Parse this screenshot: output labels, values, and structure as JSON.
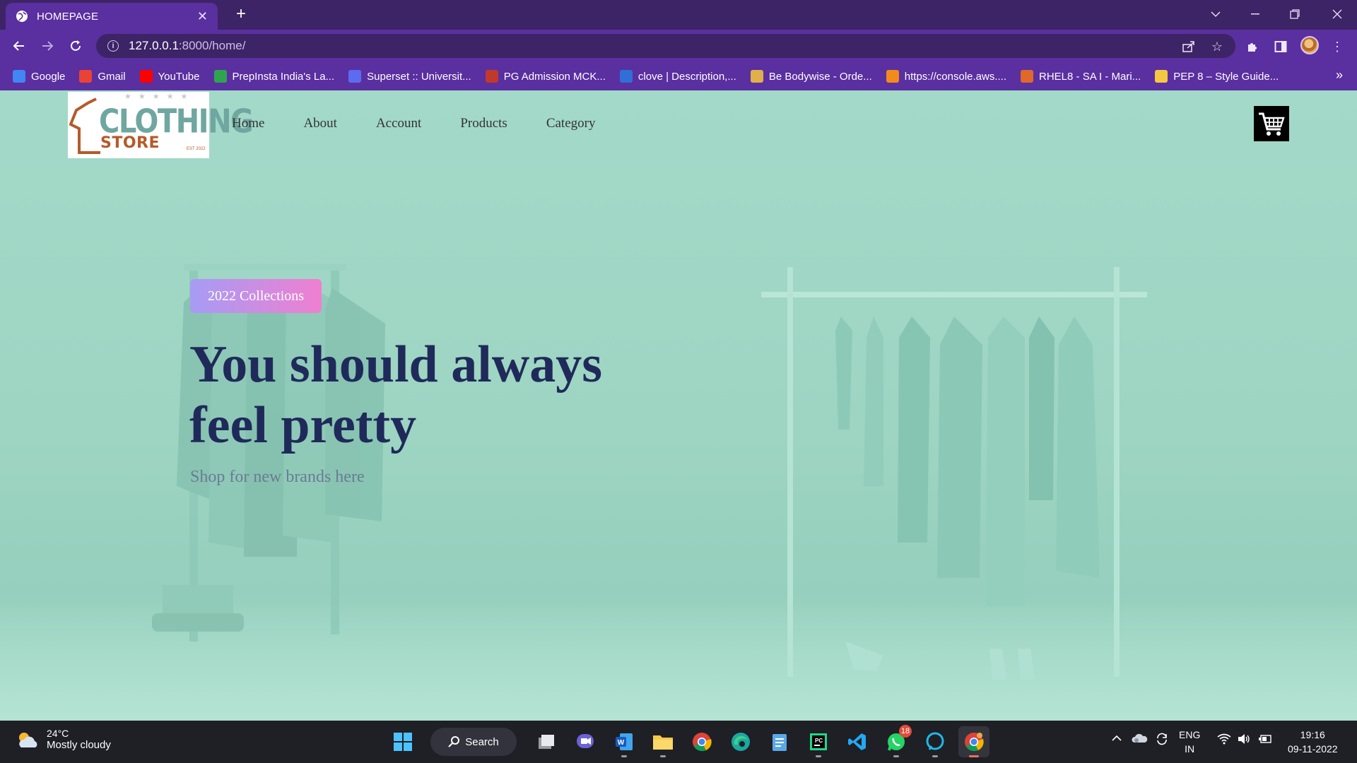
{
  "browser": {
    "tab_title": "HOMEPAGE",
    "url_host": "127.0.0.1",
    "url_path": ":8000/home/",
    "bookmarks": [
      {
        "label": "Google",
        "icon": "google-icon",
        "color": "#4285f4"
      },
      {
        "label": "Gmail",
        "icon": "gmail-icon",
        "color": "#ea4335"
      },
      {
        "label": "YouTube",
        "icon": "youtube-icon",
        "color": "#ff0000"
      },
      {
        "label": "PrepInsta India's La...",
        "icon": "prepinsta-icon",
        "color": "#2ea44f"
      },
      {
        "label": "Superset :: Universit...",
        "icon": "superset-icon",
        "color": "#5b6cf0"
      },
      {
        "label": "PG Admission MCK...",
        "icon": "pg-admission-icon",
        "color": "#c0392b"
      },
      {
        "label": "clove | Description,...",
        "icon": "clove-icon",
        "color": "#2f6fd6"
      },
      {
        "label": "Be Bodywise - Orde...",
        "icon": "bodywise-icon",
        "color": "#e0b04a"
      },
      {
        "label": "https://console.aws....",
        "icon": "aws-icon",
        "color": "#f28b1c"
      },
      {
        "label": "RHEL8 - SA I - Mari...",
        "icon": "rhel-icon",
        "color": "#e0692a"
      },
      {
        "label": "PEP 8 – Style Guide...",
        "icon": "python-icon",
        "color": "#f5c842"
      }
    ]
  },
  "site": {
    "logo": {
      "word1": "CLOTHING",
      "word2": "STORE",
      "est": "EST 2022"
    },
    "nav": [
      "Home",
      "About",
      "Account",
      "Products",
      "Category"
    ],
    "hero": {
      "badge": "2022 Collections",
      "headline_line1": "You should always",
      "headline_line2": "feel pretty",
      "subline": "Shop for new brands here"
    },
    "colors": {
      "accent_from": "#a69cf5",
      "accent_to": "#f07fd0",
      "headline": "#1f2a5a",
      "background": "#9fd6c5"
    }
  },
  "taskbar": {
    "weather_temp": "24°C",
    "weather_condition": "Mostly cloudy",
    "search_label": "Search",
    "whatsapp_badge": "18",
    "lang_top": "ENG",
    "lang_bottom": "IN",
    "time": "19:16",
    "date": "09-11-2022"
  }
}
